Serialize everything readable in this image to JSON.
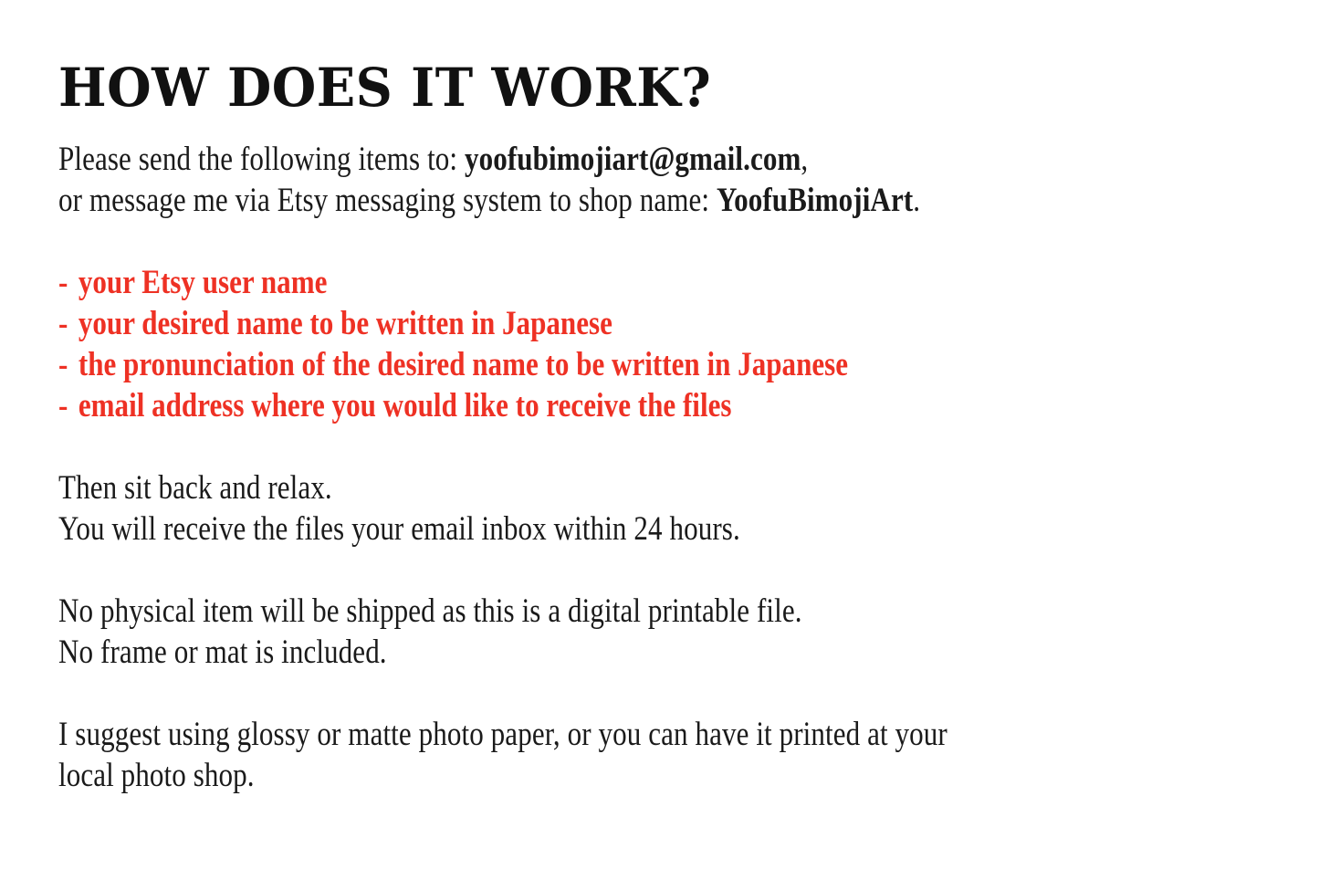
{
  "document": {
    "background_color": "#ffffff",
    "text_color": "#1a1a1a",
    "accent_color": "#ee3124",
    "title": "HOW DOES IT WORK?",
    "intro": {
      "line1_prefix": "Please send the following items to: ",
      "line1_email": "yoofubimojiart@gmail.com",
      "line1_suffix": ",",
      "line2_prefix": "or message me via Etsy messaging system to shop name: ",
      "line2_shop": "YoofuBimojiArt",
      "line2_suffix": "."
    },
    "requirements": {
      "bullet_marker": "-",
      "items": [
        "your Etsy user name",
        "your desired name to be written in Japanese",
        "the pronunciation of the desired name to be written in Japanese",
        "email address where you would like to receive the files"
      ]
    },
    "delivery": {
      "line1": "Then sit back and relax.",
      "line2": "You will receive the files your email inbox within 24 hours."
    },
    "shipping": {
      "line1": "No physical item will be shipped as this is a digital printable file.",
      "line2": "No frame or mat is included."
    },
    "printing": {
      "line1": "I suggest using glossy or matte photo paper, or you can have it printed at your",
      "line2": "local photo shop."
    }
  }
}
